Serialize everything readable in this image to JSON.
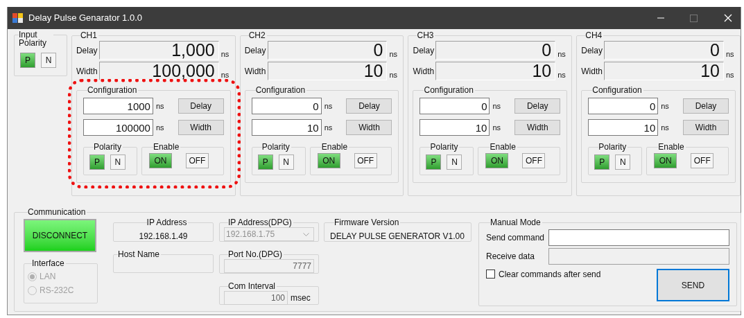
{
  "window": {
    "title": "Delay Pulse Genarator 1.0.0"
  },
  "input_polarity": {
    "title": "Input Polarity",
    "options": [
      {
        "label": "P",
        "selected": true
      },
      {
        "label": "N",
        "selected": false
      }
    ]
  },
  "channels": [
    {
      "name": "CH1",
      "highlighted": true,
      "delay_label": "Delay",
      "delay_value": "1,000",
      "delay_unit": "ns",
      "width_label": "Width",
      "width_value": "100,000",
      "width_unit": "ns",
      "configuration": {
        "title": "Configuration",
        "delay_input": "1000",
        "delay_unit": "ns",
        "delay_button": "Delay",
        "width_input": "100000",
        "width_unit": "ns",
        "width_button": "Width",
        "polarity": {
          "title": "Polarity",
          "options": [
            {
              "label": "P",
              "selected": true
            },
            {
              "label": "N",
              "selected": false
            }
          ]
        },
        "enable": {
          "title": "Enable",
          "options": [
            {
              "label": "ON",
              "selected": true
            },
            {
              "label": "OFF",
              "selected": false
            }
          ]
        }
      }
    },
    {
      "name": "CH2",
      "highlighted": false,
      "delay_label": "Delay",
      "delay_value": "0",
      "delay_unit": "ns",
      "width_label": "Width",
      "width_value": "10",
      "width_unit": "ns",
      "configuration": {
        "title": "Configuration",
        "delay_input": "0",
        "delay_unit": "ns",
        "delay_button": "Delay",
        "width_input": "10",
        "width_unit": "ns",
        "width_button": "Width",
        "polarity": {
          "title": "Polarity",
          "options": [
            {
              "label": "P",
              "selected": true
            },
            {
              "label": "N",
              "selected": false
            }
          ]
        },
        "enable": {
          "title": "Enable",
          "options": [
            {
              "label": "ON",
              "selected": true
            },
            {
              "label": "OFF",
              "selected": false
            }
          ]
        }
      }
    },
    {
      "name": "CH3",
      "highlighted": false,
      "delay_label": "Delay",
      "delay_value": "0",
      "delay_unit": "ns",
      "width_label": "Width",
      "width_value": "10",
      "width_unit": "ns",
      "configuration": {
        "title": "Configuration",
        "delay_input": "0",
        "delay_unit": "ns",
        "delay_button": "Delay",
        "width_input": "10",
        "width_unit": "ns",
        "width_button": "Width",
        "polarity": {
          "title": "Polarity",
          "options": [
            {
              "label": "P",
              "selected": true
            },
            {
              "label": "N",
              "selected": false
            }
          ]
        },
        "enable": {
          "title": "Enable",
          "options": [
            {
              "label": "ON",
              "selected": true
            },
            {
              "label": "OFF",
              "selected": false
            }
          ]
        }
      }
    },
    {
      "name": "CH4",
      "highlighted": false,
      "delay_label": "Delay",
      "delay_value": "0",
      "delay_unit": "ns",
      "width_label": "Width",
      "width_value": "10",
      "width_unit": "ns",
      "configuration": {
        "title": "Configuration",
        "delay_input": "0",
        "delay_unit": "ns",
        "delay_button": "Delay",
        "width_input": "10",
        "width_unit": "ns",
        "width_button": "Width",
        "polarity": {
          "title": "Polarity",
          "options": [
            {
              "label": "P",
              "selected": true
            },
            {
              "label": "N",
              "selected": false
            }
          ]
        },
        "enable": {
          "title": "Enable",
          "options": [
            {
              "label": "ON",
              "selected": true
            },
            {
              "label": "OFF",
              "selected": false
            }
          ]
        }
      }
    }
  ],
  "communication": {
    "title": "Communication",
    "connect_button": "DISCONNECT",
    "interface": {
      "title": "Interface",
      "disabled": true,
      "options": [
        {
          "label": "LAN",
          "selected": true
        },
        {
          "label": "RS-232C",
          "selected": false
        }
      ]
    },
    "ip_address": {
      "title": "IP Address",
      "value": "192.168.1.49"
    },
    "host_name": {
      "title": "Host Name"
    },
    "ip_address_dpg": {
      "title": "IP Address(DPG)",
      "value": "192.168.1.75"
    },
    "port_dpg": {
      "title": "Port No.(DPG)",
      "value": "7777"
    },
    "com_interval": {
      "title": "Com Interval",
      "value": "100",
      "unit": "msec"
    },
    "firmware": {
      "title": "Firmware Version",
      "value": "DELAY PULSE GENERATOR V1.00"
    },
    "manual_mode": {
      "title": "Manual Mode",
      "send_label": "Send command",
      "receive_label": "Receive data",
      "clear_option": {
        "label": "Clear commands after send",
        "checked": false
      },
      "send_button": "SEND"
    }
  }
}
